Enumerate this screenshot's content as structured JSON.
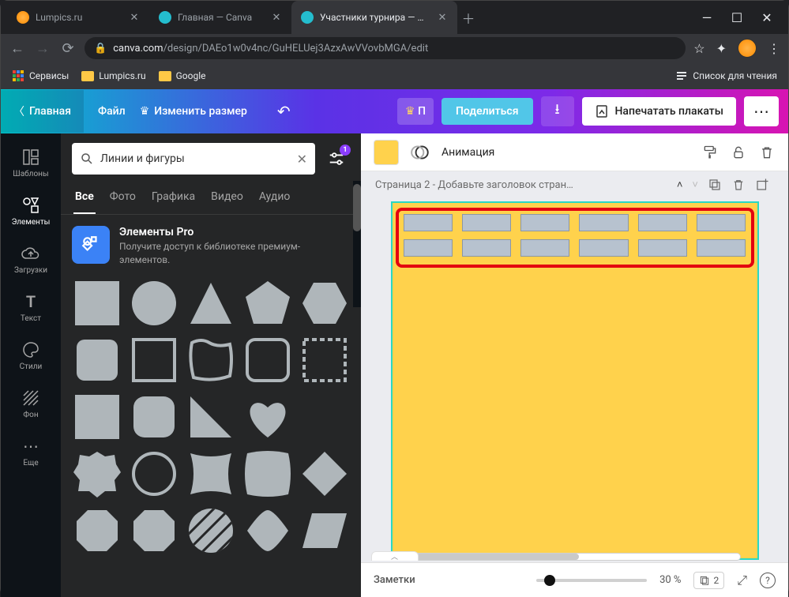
{
  "browser": {
    "tabs": [
      {
        "title": "Lumpics.ru",
        "icon_color": "#ff8c00",
        "active": false
      },
      {
        "title": "Главная — Canva",
        "icon_color": "#24bdce",
        "active": false
      },
      {
        "title": "Участники турнира — Плакат",
        "icon_color": "#24bdce",
        "active": true
      }
    ],
    "url_host": "canva.com",
    "url_path": "/design/DAEo1w0v4nc/GuHELUej3AzxAwVVovbMGA/edit",
    "bookmarks": {
      "apps": "Сервисы",
      "items": [
        "Lumpics.ru",
        "Google"
      ],
      "readlist": "Список для чтения"
    }
  },
  "canva_top": {
    "home": "Главная",
    "file": "Файл",
    "resize": "Изменить размер",
    "premium_badge": "П",
    "share": "Поделиться",
    "print": "Напечатать плакаты"
  },
  "rail": [
    {
      "label": "Шаблоны",
      "icon": "templates"
    },
    {
      "label": "Элементы",
      "icon": "elements",
      "active": true
    },
    {
      "label": "Загрузки",
      "icon": "uploads"
    },
    {
      "label": "Текст",
      "icon": "text"
    },
    {
      "label": "Стили",
      "icon": "styles"
    },
    {
      "label": "Фон",
      "icon": "bg"
    },
    {
      "label": "Еще",
      "icon": "more"
    }
  ],
  "panel": {
    "search_value": "Линии и фигуры",
    "filter_badge": "1",
    "tabs": [
      "Все",
      "Фото",
      "Графика",
      "Видео",
      "Аудио"
    ],
    "active_tab": 0,
    "promo": {
      "title": "Элементы Pro",
      "body": "Получите доступ к библиотеке премиум-элементов."
    }
  },
  "canvas": {
    "animate": "Анимация",
    "page_title": "Страница 2 - Добавьте заголовок стран…",
    "canvas_color": "#ffd24c",
    "notes": "Заметки",
    "zoom": "30 %",
    "page_count": "2"
  }
}
